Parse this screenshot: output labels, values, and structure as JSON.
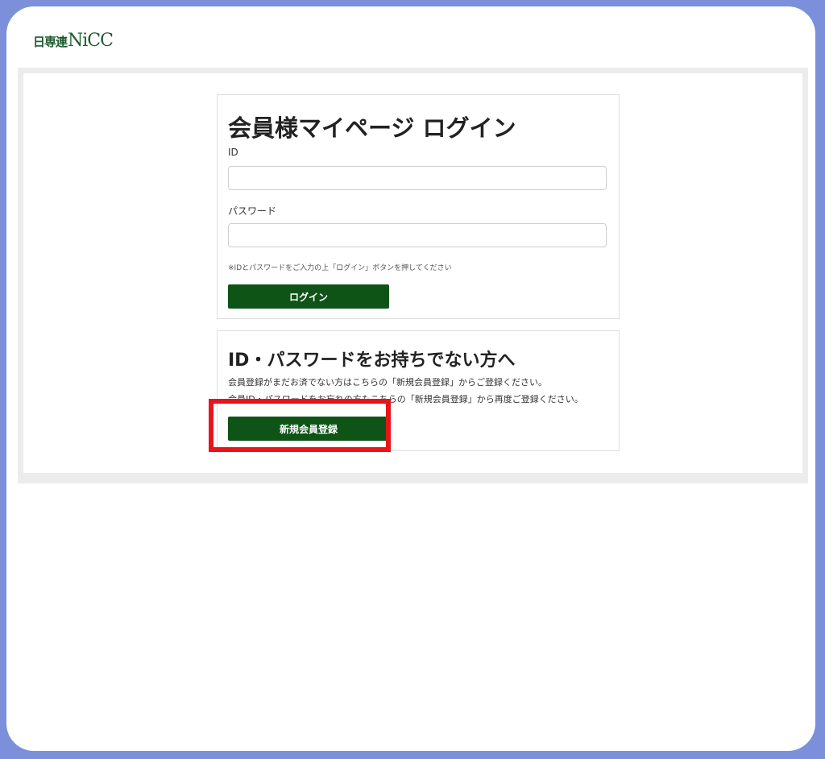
{
  "logo": {
    "text_jp": "日専連",
    "text_en": "NiCC"
  },
  "login": {
    "title": "会員様マイページ ログイン",
    "id_label": "ID",
    "id_value": "",
    "password_label": "パスワード",
    "password_value": "",
    "note": "※IDとパスワードをご入力の上「ログイン」ボタンを押してください",
    "button": "ログイン"
  },
  "register": {
    "title": "ID・パスワードをお持ちでない方へ",
    "desc1": "会員登録がまだお済でない方はこちらの「新規会員登録」からご登録ください。",
    "desc2": "会員ID・パスワードをお忘れの方もこちらの「新規会員登録」から再度ご登録ください。",
    "button": "新規会員登録"
  },
  "colors": {
    "button_bg": "#0e5417",
    "highlight": "#e8141b",
    "outer_border": "#7b8fdb"
  }
}
